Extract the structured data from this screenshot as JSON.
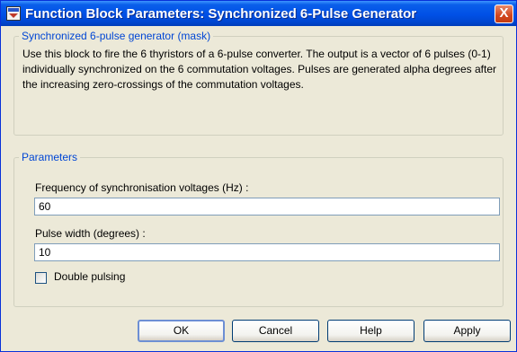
{
  "window": {
    "title": "Function Block Parameters: Synchronized 6-Pulse Generator",
    "close_label": "X"
  },
  "mask": {
    "legend": "Synchronized 6-pulse generator (mask)",
    "description": "Use this block to fire the 6 thyristors of a 6-pulse converter. The output is a vector of 6 pulses (0-1) individually synchronized on the 6 commutation voltages. Pulses are generated alpha degrees after the increasing zero-crossings of the commutation voltages."
  },
  "parameters": {
    "legend": "Parameters",
    "frequency_label": "Frequency of synchronisation voltages (Hz) :",
    "frequency_value": "60",
    "pulse_width_label": "Pulse width (degrees) :",
    "pulse_width_value": "10",
    "double_pulsing_label": "Double pulsing",
    "double_pulsing_checked": false
  },
  "buttons": {
    "ok": "OK",
    "cancel": "Cancel",
    "help": "Help",
    "apply": "Apply"
  },
  "colors": {
    "title_bar": "#0050e6",
    "group_legend": "#0046d5",
    "dialog_bg": "#ece9d8",
    "close_button": "#d1451e"
  },
  "icons": {
    "title": "simulink-block-icon",
    "close": "close-icon"
  }
}
